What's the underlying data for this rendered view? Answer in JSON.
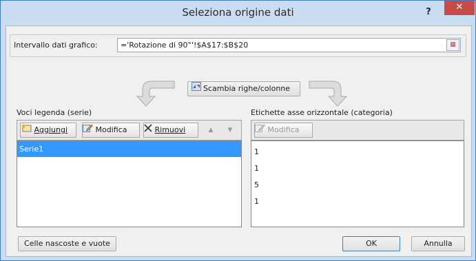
{
  "window": {
    "title": "Seleziona origine dati",
    "help_glyph": "?",
    "close_glyph": "✕"
  },
  "range": {
    "label": "Intervallo dati grafico:",
    "value": "='Rotazione di 90°'!$A$17:$B$20"
  },
  "switch": {
    "label": "Scambia righe/colonne"
  },
  "legend": {
    "heading": "Voci legenda (serie)",
    "add_label": "Aggiungi",
    "edit_label": "Modifica",
    "remove_label": "Rimuovi",
    "up_glyph": "▲",
    "down_glyph": "▼",
    "series": [
      "Serie1"
    ]
  },
  "axis": {
    "heading": "Etichette asse orizzontale (categoria)",
    "edit_label": "Modifica",
    "categories": [
      "1",
      "1",
      "5",
      "1"
    ]
  },
  "footer": {
    "hidden_label": "Celle nascoste e vuote",
    "ok_label": "OK",
    "cancel_label": "Annulla"
  },
  "colors": {
    "selection": "#3399ff",
    "close": "#c74b4a",
    "frame": "#c9dcf2"
  }
}
